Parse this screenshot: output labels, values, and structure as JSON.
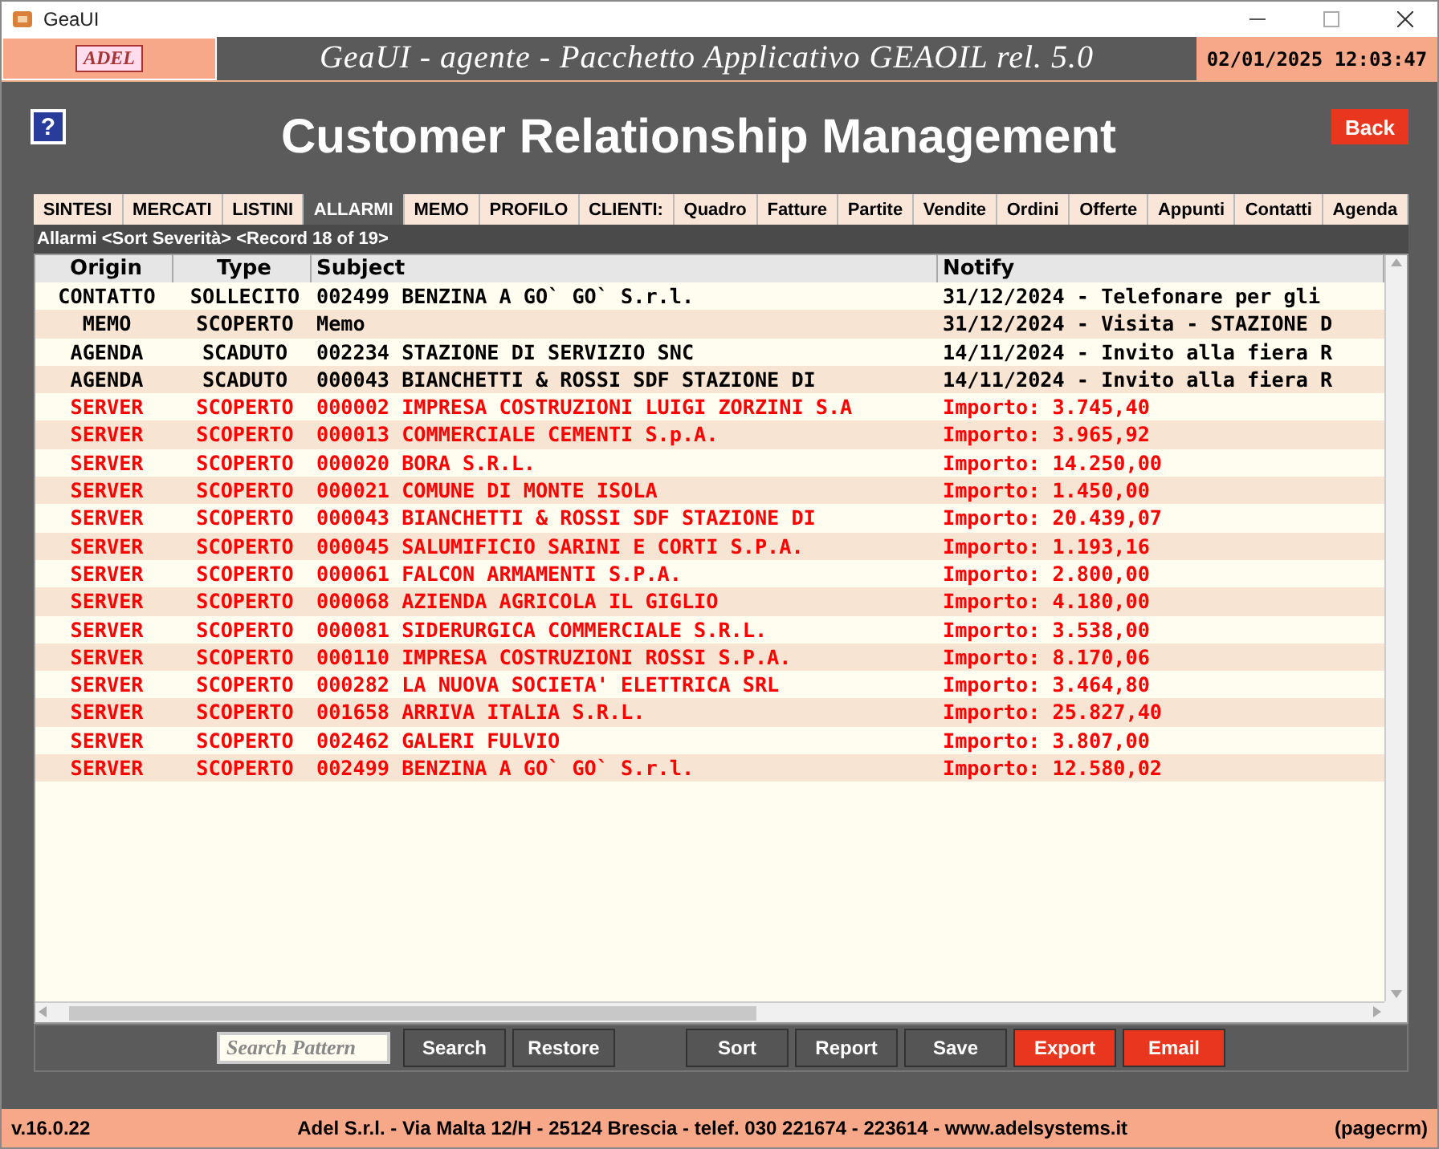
{
  "window": {
    "title": "GeaUI"
  },
  "header": {
    "logo": "ADEL",
    "banner": "GeaUI - agente - Pacchetto Applicativo GEAOIL rel. 5.0",
    "datetime": "02/01/2025 12:03:47"
  },
  "page": {
    "help": "?",
    "title": "Customer Relationship Management",
    "back": "Back"
  },
  "tabs": [
    {
      "label": "SINTESI",
      "selected": false
    },
    {
      "label": "MERCATI",
      "selected": false
    },
    {
      "label": "LISTINI",
      "selected": false
    },
    {
      "label": "ALLARMI",
      "selected": true
    },
    {
      "label": "MEMO",
      "selected": false
    },
    {
      "label": "PROFILO",
      "selected": false
    },
    {
      "label": "CLIENTI:",
      "selected": false
    },
    {
      "label": "Quadro",
      "selected": false
    },
    {
      "label": "Fatture",
      "selected": false
    },
    {
      "label": "Partite",
      "selected": false
    },
    {
      "label": "Vendite",
      "selected": false
    },
    {
      "label": "Ordini",
      "selected": false
    },
    {
      "label": "Offerte",
      "selected": false
    },
    {
      "label": "Appunti",
      "selected": false
    },
    {
      "label": "Contatti",
      "selected": false
    },
    {
      "label": "Agenda",
      "selected": false
    }
  ],
  "info": "Allarmi <Sort Severità> <Record 18 of  19>",
  "table": {
    "columns": [
      "Origin",
      "Type",
      "Subject",
      "Notify"
    ],
    "rows": [
      {
        "kind": "notice",
        "origin": "CONTATTO",
        "type": "SOLLECITO",
        "subject": "002499 BENZINA A GO` GO` S.r.l.",
        "notify": "31/12/2024 - Telefonare per gli"
      },
      {
        "kind": "notice",
        "origin": "MEMO",
        "type": "SCOPERTO",
        "subject": "Memo",
        "notify": "31/12/2024 - Visita - STAZIONE D"
      },
      {
        "kind": "notice",
        "origin": "AGENDA",
        "type": "SCADUTO",
        "subject": "002234 STAZIONE DI SERVIZIO SNC",
        "notify": "14/11/2024 - Invito alla fiera R"
      },
      {
        "kind": "notice",
        "origin": "AGENDA",
        "type": "SCADUTO",
        "subject": "000043 BIANCHETTI & ROSSI SDF STAZIONE DI",
        "notify": "14/11/2024 - Invito alla fiera R"
      },
      {
        "kind": "alarm",
        "origin": "SERVER",
        "type": "SCOPERTO",
        "subject": "000002 IMPRESA COSTRUZIONI LUIGI ZORZINI S.A",
        "notify": "Importo: 3.745,40"
      },
      {
        "kind": "alarm",
        "origin": "SERVER",
        "type": "SCOPERTO",
        "subject": "000013 COMMERCIALE CEMENTI S.p.A.",
        "notify": "Importo: 3.965,92"
      },
      {
        "kind": "alarm",
        "origin": "SERVER",
        "type": "SCOPERTO",
        "subject": "000020 BORA S.R.L.",
        "notify": "Importo: 14.250,00"
      },
      {
        "kind": "alarm",
        "origin": "SERVER",
        "type": "SCOPERTO",
        "subject": "000021 COMUNE DI MONTE ISOLA",
        "notify": "Importo: 1.450,00"
      },
      {
        "kind": "alarm",
        "origin": "SERVER",
        "type": "SCOPERTO",
        "subject": "000043 BIANCHETTI & ROSSI SDF STAZIONE DI",
        "notify": "Importo: 20.439,07"
      },
      {
        "kind": "alarm",
        "origin": "SERVER",
        "type": "SCOPERTO",
        "subject": "000045 SALUMIFICIO SARINI E CORTI S.P.A.",
        "notify": "Importo: 1.193,16"
      },
      {
        "kind": "alarm",
        "origin": "SERVER",
        "type": "SCOPERTO",
        "subject": "000061 FALCON ARMAMENTI S.P.A.",
        "notify": "Importo: 2.800,00"
      },
      {
        "kind": "alarm",
        "origin": "SERVER",
        "type": "SCOPERTO",
        "subject": "000068 AZIENDA AGRICOLA IL GIGLIO",
        "notify": "Importo: 4.180,00"
      },
      {
        "kind": "alarm",
        "origin": "SERVER",
        "type": "SCOPERTO",
        "subject": "000081 SIDERURGICA COMMERCIALE S.R.L.",
        "notify": "Importo: 3.538,00"
      },
      {
        "kind": "alarm",
        "origin": "SERVER",
        "type": "SCOPERTO",
        "subject": "000110 IMPRESA COSTRUZIONI ROSSI S.P.A.",
        "notify": "Importo: 8.170,06"
      },
      {
        "kind": "alarm",
        "origin": "SERVER",
        "type": "SCOPERTO",
        "subject": "000282 LA NUOVA SOCIETA' ELETTRICA SRL",
        "notify": "Importo: 3.464,80"
      },
      {
        "kind": "alarm",
        "origin": "SERVER",
        "type": "SCOPERTO",
        "subject": "001658 ARRIVA ITALIA S.R.L.",
        "notify": "Importo: 25.827,40"
      },
      {
        "kind": "alarm",
        "origin": "SERVER",
        "type": "SCOPERTO",
        "subject": "002462 GALERI FULVIO",
        "notify": "Importo: 3.807,00"
      },
      {
        "kind": "alarm",
        "origin": "SERVER",
        "type": "SCOPERTO",
        "subject": "002499 BENZINA A GO` GO` S.r.l.",
        "notify": "Importo: 12.580,02"
      }
    ]
  },
  "search": {
    "placeholder": "Search Pattern"
  },
  "buttons": [
    {
      "label": "Search",
      "accent": false
    },
    {
      "label": "Restore",
      "accent": false
    },
    {
      "label": "Sort",
      "accent": false
    },
    {
      "label": "Report",
      "accent": false
    },
    {
      "label": "Save",
      "accent": false
    },
    {
      "label": "Export",
      "accent": true
    },
    {
      "label": "Email",
      "accent": true
    }
  ],
  "footer": {
    "version": "v.16.0.22",
    "company": "Adel S.r.l. - Via Malta 12/H - 25124 Brescia - telef. 030 221674 - 223614 - www.adelsystems.it",
    "page": "(pagecrm)"
  }
}
